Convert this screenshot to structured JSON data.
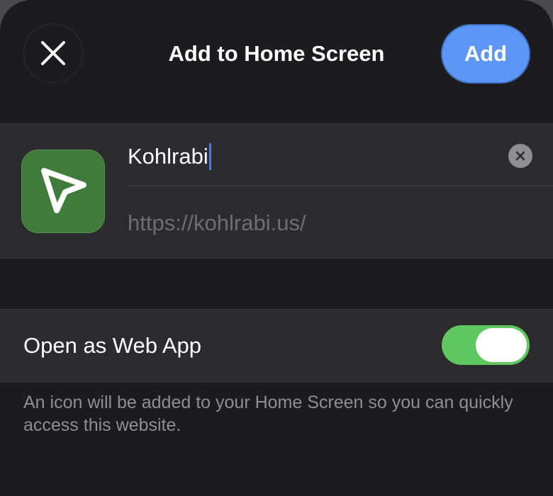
{
  "header": {
    "title": "Add to Home Screen",
    "add_label": "Add"
  },
  "bookmark": {
    "name_value": "Kohlrabi",
    "url": "https://kohlrabi.us/"
  },
  "web_app": {
    "label": "Open as Web App",
    "enabled": true
  },
  "footer": {
    "text": "An icon will be added to your Home Screen so you can quickly access this website."
  },
  "colors": {
    "background": "#1c1c1e",
    "card": "#2c2c2e",
    "accent_blue": "#5c97f5",
    "toggle_green": "#5fc75f",
    "app_icon_green": "#3f7b3a"
  },
  "icons": {
    "close": "close-icon",
    "clear": "clear-x-icon",
    "app": "navigation-arrow-icon"
  }
}
